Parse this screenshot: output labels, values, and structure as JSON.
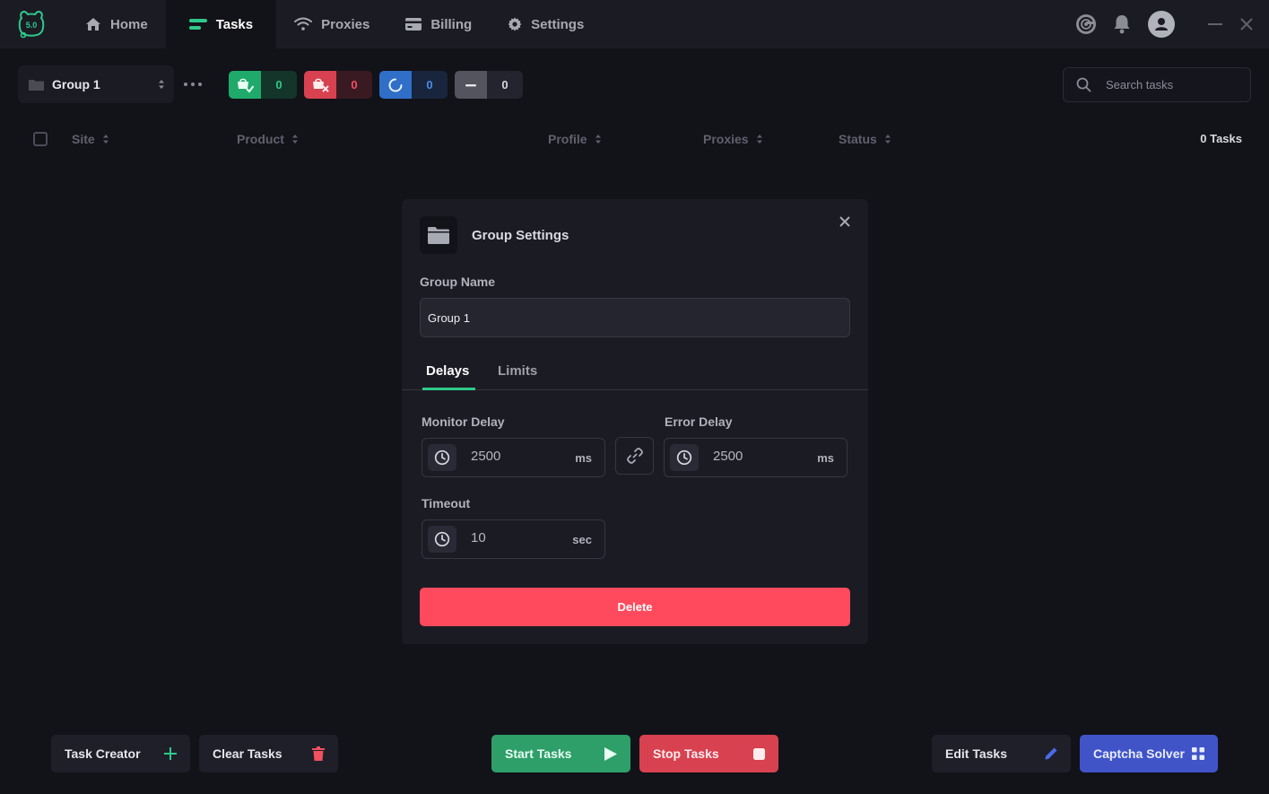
{
  "app": {
    "logo_text": "5.0"
  },
  "nav": {
    "items": [
      {
        "label": "Home",
        "icon": "home-icon"
      },
      {
        "label": "Tasks",
        "icon": "tasks-icon"
      },
      {
        "label": "Proxies",
        "icon": "wifi-icon"
      },
      {
        "label": "Billing",
        "icon": "card-icon"
      },
      {
        "label": "Settings",
        "icon": "gear-icon"
      }
    ],
    "active": "Tasks"
  },
  "toolbar": {
    "group_label": "Group 1",
    "counters": [
      {
        "name": "success",
        "value": "0",
        "icon": "cart-check-icon",
        "icon_bg": "#1faa6b",
        "num_bg": "#14352a",
        "num_color": "#2ec98a"
      },
      {
        "name": "failed",
        "value": "0",
        "icon": "cart-x-icon",
        "icon_bg": "#d8414f",
        "num_bg": "#3a1a22",
        "num_color": "#f0505f"
      },
      {
        "name": "running",
        "value": "0",
        "icon": "spinner-icon",
        "icon_bg": "#2f6fc8",
        "num_bg": "#18253d",
        "num_color": "#4a8ae8"
      },
      {
        "name": "idle",
        "value": "0",
        "icon": "minus-icon",
        "icon_bg": "#53545e",
        "num_bg": "#23242d",
        "num_color": "#d6d7de"
      }
    ],
    "search_placeholder": "Search tasks"
  },
  "table": {
    "columns": [
      "Site",
      "Product",
      "Profile",
      "Proxies",
      "Status"
    ],
    "task_count": "0 Tasks"
  },
  "modal": {
    "title": "Group Settings",
    "group_name_label": "Group Name",
    "group_name_value": "Group 1",
    "tabs": [
      "Delays",
      "Limits"
    ],
    "active_tab": "Delays",
    "monitor_delay_label": "Monitor Delay",
    "monitor_delay_value": "2500",
    "monitor_delay_unit": "ms",
    "error_delay_label": "Error Delay",
    "error_delay_value": "2500",
    "error_delay_unit": "ms",
    "timeout_label": "Timeout",
    "timeout_value": "10",
    "timeout_unit": "sec",
    "delete_label": "Delete"
  },
  "bottom": {
    "task_creator": "Task Creator",
    "clear_tasks": "Clear Tasks",
    "start_tasks": "Start Tasks",
    "stop_tasks": "Stop Tasks",
    "edit_tasks": "Edit Tasks",
    "captcha_solver": "Captcha Solver"
  },
  "colors": {
    "accent_green": "#2ec98a",
    "danger": "#ff4a5d",
    "start_green": "#2f9f6a",
    "stop_red": "#d8414f",
    "captcha_blue": "#4054c8"
  }
}
